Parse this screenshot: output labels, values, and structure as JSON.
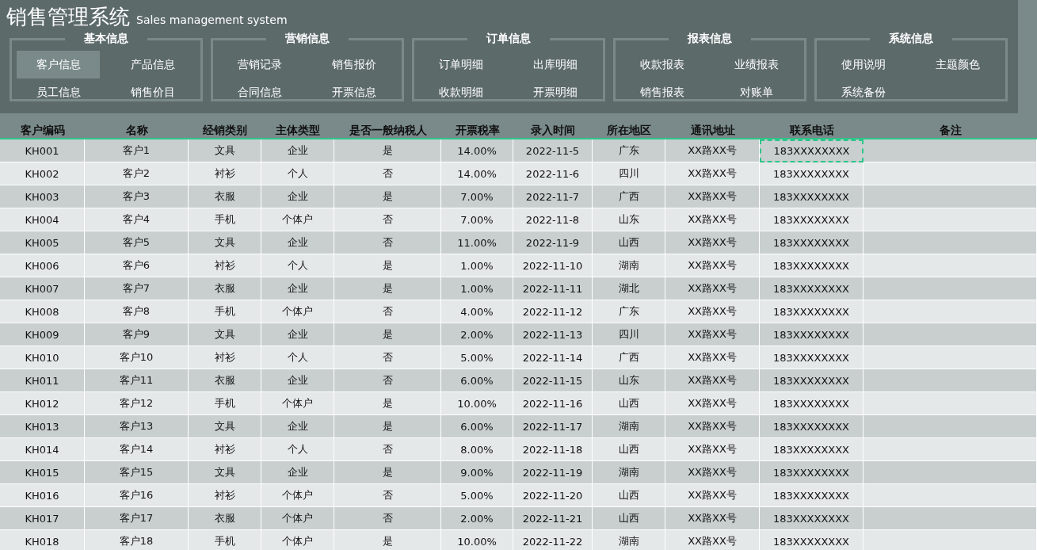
{
  "app": {
    "title": "销售管理系统",
    "subtitle": "Sales management system"
  },
  "nav_groups": [
    {
      "title": "基本信息",
      "items": [
        {
          "label": "客户信息",
          "selected": true
        },
        {
          "label": "产品信息",
          "selected": false
        },
        {
          "label": "员工信息",
          "selected": false
        },
        {
          "label": "销售价目",
          "selected": false
        }
      ]
    },
    {
      "title": "营销信息",
      "items": [
        {
          "label": "营销记录",
          "selected": false
        },
        {
          "label": "销售报价",
          "selected": false
        },
        {
          "label": "合同信息",
          "selected": false
        },
        {
          "label": "开票信息",
          "selected": false
        }
      ]
    },
    {
      "title": "订单信息",
      "items": [
        {
          "label": "订单明细",
          "selected": false
        },
        {
          "label": "出库明细",
          "selected": false
        },
        {
          "label": "收款明细",
          "selected": false
        },
        {
          "label": "开票明细",
          "selected": false
        }
      ]
    },
    {
      "title": "报表信息",
      "items": [
        {
          "label": "收款报表",
          "selected": false
        },
        {
          "label": "业绩报表",
          "selected": false
        },
        {
          "label": "销售报表",
          "selected": false
        },
        {
          "label": "对账单",
          "selected": false
        }
      ]
    },
    {
      "title": "系统信息",
      "items": [
        {
          "label": "使用说明",
          "selected": false
        },
        {
          "label": "主题颜色",
          "selected": false
        },
        {
          "label": "系统备份",
          "selected": false
        }
      ]
    }
  ],
  "table": {
    "columns": [
      "客户编码",
      "名称",
      "经销类别",
      "主体类型",
      "是否一般纳税人",
      "开票税率",
      "录入时间",
      "所在地区",
      "通讯地址",
      "联系电话",
      "备注"
    ],
    "rows": [
      {
        "cells": [
          "KH001",
          "客户1",
          "文具",
          "企业",
          "是",
          "14.00%",
          "2022-11-5",
          "广东",
          "XX路XX号",
          "183XXXXXXXX"
        ],
        "selected": true
      },
      {
        "cells": [
          "KH002",
          "客户2",
          "衬衫",
          "个人",
          "否",
          "14.00%",
          "2022-11-6",
          "四川",
          "XX路XX号",
          "183XXXXXXXX"
        ],
        "selected": false
      },
      {
        "cells": [
          "KH003",
          "客户3",
          "衣服",
          "企业",
          "是",
          "7.00%",
          "2022-11-7",
          "广西",
          "XX路XX号",
          "183XXXXXXXX"
        ],
        "selected": false
      },
      {
        "cells": [
          "KH004",
          "客户4",
          "手机",
          "个体户",
          "否",
          "7.00%",
          "2022-11-8",
          "山东",
          "XX路XX号",
          "183XXXXXXXX"
        ],
        "selected": false
      },
      {
        "cells": [
          "KH005",
          "客户5",
          "文具",
          "企业",
          "否",
          "11.00%",
          "2022-11-9",
          "山西",
          "XX路XX号",
          "183XXXXXXXX"
        ],
        "selected": false
      },
      {
        "cells": [
          "KH006",
          "客户6",
          "衬衫",
          "个人",
          "是",
          "1.00%",
          "2022-11-10",
          "湖南",
          "XX路XX号",
          "183XXXXXXXX"
        ],
        "selected": false
      },
      {
        "cells": [
          "KH007",
          "客户7",
          "衣服",
          "企业",
          "是",
          "1.00%",
          "2022-11-11",
          "湖北",
          "XX路XX号",
          "183XXXXXXXX"
        ],
        "selected": false
      },
      {
        "cells": [
          "KH008",
          "客户8",
          "手机",
          "个体户",
          "否",
          "4.00%",
          "2022-11-12",
          "广东",
          "XX路XX号",
          "183XXXXXXXX"
        ],
        "selected": false
      },
      {
        "cells": [
          "KH009",
          "客户9",
          "文具",
          "企业",
          "是",
          "2.00%",
          "2022-11-13",
          "四川",
          "XX路XX号",
          "183XXXXXXXX"
        ],
        "selected": false
      },
      {
        "cells": [
          "KH010",
          "客户10",
          "衬衫",
          "个人",
          "否",
          "5.00%",
          "2022-11-14",
          "广西",
          "XX路XX号",
          "183XXXXXXXX"
        ],
        "selected": false
      },
      {
        "cells": [
          "KH011",
          "客户11",
          "衣服",
          "企业",
          "否",
          "6.00%",
          "2022-11-15",
          "山东",
          "XX路XX号",
          "183XXXXXXXX"
        ],
        "selected": false
      },
      {
        "cells": [
          "KH012",
          "客户12",
          "手机",
          "个体户",
          "是",
          "10.00%",
          "2022-11-16",
          "山西",
          "XX路XX号",
          "183XXXXXXXX"
        ],
        "selected": false
      },
      {
        "cells": [
          "KH013",
          "客户13",
          "文具",
          "企业",
          "是",
          "6.00%",
          "2022-11-17",
          "湖南",
          "XX路XX号",
          "183XXXXXXXX"
        ],
        "selected": false
      },
      {
        "cells": [
          "KH014",
          "客户14",
          "衬衫",
          "个人",
          "否",
          "8.00%",
          "2022-11-18",
          "山西",
          "XX路XX号",
          "183XXXXXXXX"
        ],
        "selected": false
      },
      {
        "cells": [
          "KH015",
          "客户15",
          "文具",
          "企业",
          "是",
          "9.00%",
          "2022-11-19",
          "湖南",
          "XX路XX号",
          "183XXXXXXXX"
        ],
        "selected": false
      },
      {
        "cells": [
          "KH016",
          "客户16",
          "衬衫",
          "个体户",
          "否",
          "5.00%",
          "2022-11-20",
          "山西",
          "XX路XX号",
          "183XXXXXXXX"
        ],
        "selected": false
      },
      {
        "cells": [
          "KH017",
          "客户17",
          "衣服",
          "个体户",
          "否",
          "2.00%",
          "2022-11-21",
          "山西",
          "XX路XX号",
          "183XXXXXXXX"
        ],
        "selected": false
      },
      {
        "cells": [
          "KH018",
          "客户18",
          "手机",
          "个体户",
          "是",
          "10.00%",
          "2022-11-22",
          "湖南",
          "XX路XX号",
          "183XXXXXXXX"
        ],
        "selected": false
      }
    ]
  }
}
